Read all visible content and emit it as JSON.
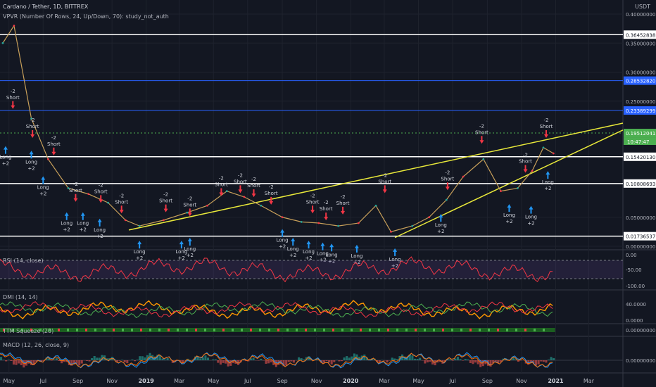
{
  "header": {
    "symbol_line": "Cardano / Tether, 1D, BITTREX",
    "indicator_line": "VPVR (Number Of Rows, 24, Up/Down, 70): study_not_auth",
    "currency": "USDT"
  },
  "price_axis": {
    "ticks": [
      "0.40000000",
      "0.35000000",
      "0.30000000",
      "0.25000000",
      "0.05000000",
      "0.00000000"
    ],
    "levels": [
      {
        "value": "0.36452838",
        "style": "white"
      },
      {
        "value": "0.28532820",
        "style": "blue"
      },
      {
        "value": "0.23389299",
        "style": "blue"
      },
      {
        "value": "0.19512041",
        "style": "green"
      },
      {
        "value": "0.15420130",
        "style": "white"
      },
      {
        "value": "0.10808693",
        "style": "white"
      },
      {
        "value": "0.01736537",
        "style": "white"
      }
    ],
    "countdown": "10:47:47"
  },
  "time_axis": [
    "May",
    "Jul",
    "Sep",
    "Nov",
    "2019",
    "Mar",
    "May",
    "Jul",
    "Sep",
    "Nov",
    "2020",
    "Mar",
    "May",
    "Jul",
    "Sep",
    "Nov",
    "2021",
    "Mar"
  ],
  "indicators": {
    "rsi": {
      "label": "RSI (14, close)",
      "ticks": [
        "0.00",
        "-50.00",
        "-100.00"
      ]
    },
    "dmi": {
      "label": "DMI (14, 14)",
      "ticks": [
        "40.0000",
        "0.0000"
      ]
    },
    "squeeze": {
      "label": "TTM Squeeze (20)",
      "ticks": [
        "0.00000000"
      ]
    },
    "macd": {
      "label": "MACD (12, 26, close, 9)",
      "ticks": [
        "0.00000000"
      ]
    }
  },
  "colors": {
    "long": "#2196f3",
    "short": "#f23645",
    "trend": "#e8e83a",
    "level_blue": "#2962ff",
    "level_green": "#4caf50"
  },
  "chart_data": {
    "type": "line",
    "title": "Cardano / Tether, 1D, BITTREX",
    "x": [
      "2018-04-20",
      "2018-05-10",
      "2018-06-10",
      "2018-07-10",
      "2018-08-15",
      "2018-09-20",
      "2018-10-25",
      "2018-11-25",
      "2018-12-20",
      "2019-02-01",
      "2019-03-15",
      "2019-04-20",
      "2019-05-25",
      "2019-06-25",
      "2019-07-25",
      "2019-09-01",
      "2019-10-05",
      "2019-11-05",
      "2019-12-10",
      "2020-01-15",
      "2020-02-15",
      "2020-03-13",
      "2020-04-20",
      "2020-05-20",
      "2020-06-20",
      "2020-07-20",
      "2020-08-25",
      "2020-09-25",
      "2020-10-25",
      "2020-11-20",
      "2020-12-10",
      "2020-12-28"
    ],
    "series": [
      {
        "values": [
          0.35,
          0.38,
          0.22,
          0.15,
          0.1,
          0.09,
          0.075,
          0.045,
          0.035,
          0.045,
          0.058,
          0.07,
          0.095,
          0.085,
          0.07,
          0.05,
          0.042,
          0.04,
          0.035,
          0.04,
          0.07,
          0.025,
          0.035,
          0.05,
          0.08,
          0.12,
          0.15,
          0.095,
          0.1,
          0.13,
          0.17,
          0.16
        ]
      }
    ],
    "ylim": [
      0,
      0.4
    ]
  },
  "annotations": [
    {
      "kind": "short",
      "text": [
        "-2",
        "Short"
      ],
      "date": "2018-05-08",
      "price": 0.25
    },
    {
      "kind": "short",
      "text": [
        "-2",
        "Short"
      ],
      "date": "2018-06-12",
      "price": 0.2
    },
    {
      "kind": "long",
      "text": [
        "Long",
        "+2"
      ],
      "date": "2018-04-25",
      "price": 0.158
    },
    {
      "kind": "long",
      "text": [
        "Long",
        "+2"
      ],
      "date": "2018-06-10",
      "price": 0.15
    },
    {
      "kind": "short",
      "text": [
        "-2",
        "Short"
      ],
      "date": "2018-07-20",
      "price": 0.17
    },
    {
      "kind": "long",
      "text": [
        "Long",
        "+2"
      ],
      "date": "2018-07-01",
      "price": 0.106
    },
    {
      "kind": "short",
      "text": [
        "-2",
        "Short"
      ],
      "date": "2018-08-28",
      "price": 0.09
    },
    {
      "kind": "long",
      "text": [
        "Long",
        "+2"
      ],
      "date": "2018-08-12",
      "price": 0.044
    },
    {
      "kind": "short",
      "text": [
        "-2",
        "Short"
      ],
      "date": "2018-10-12",
      "price": 0.088
    },
    {
      "kind": "short",
      "text": [
        "-2",
        "Short"
      ],
      "date": "2018-11-18",
      "price": 0.07
    },
    {
      "kind": "long",
      "text": [
        "Long",
        "+2"
      ],
      "date": "2018-09-10",
      "price": 0.044
    },
    {
      "kind": "long",
      "text": [
        "Long",
        "+2"
      ],
      "date": "2018-10-10",
      "price": 0.033
    },
    {
      "kind": "long",
      "text": [
        "Long",
        "+2"
      ],
      "date": "2018-12-20",
      "price": -0.005
    },
    {
      "kind": "short",
      "text": [
        "-2",
        "Short"
      ],
      "date": "2019-02-05",
      "price": 0.072
    },
    {
      "kind": "long",
      "text": [
        "Long",
        "+2"
      ],
      "date": "2019-03-05",
      "price": -0.005
    },
    {
      "kind": "short",
      "text": [
        "-2",
        "Short"
      ],
      "date": "2019-03-20",
      "price": 0.065
    },
    {
      "kind": "long",
      "text": [
        "Long",
        "+2"
      ],
      "date": "2019-03-20",
      "price": 0.0
    },
    {
      "kind": "short",
      "text": [
        "-2",
        "Short"
      ],
      "date": "2019-05-15",
      "price": 0.1
    },
    {
      "kind": "short",
      "text": [
        "-2",
        "Short"
      ],
      "date": "2019-06-18",
      "price": 0.105
    },
    {
      "kind": "short",
      "text": [
        "-2",
        "Short"
      ],
      "date": "2019-07-12",
      "price": 0.098
    },
    {
      "kind": "short",
      "text": [
        "-2",
        "Short"
      ],
      "date": "2019-08-12",
      "price": 0.085
    },
    {
      "kind": "long",
      "text": [
        "Long",
        "+2"
      ],
      "date": "2019-09-01",
      "price": 0.015
    },
    {
      "kind": "long",
      "text": [
        "Long",
        "+2"
      ],
      "date": "2019-09-20",
      "price": 0.0
    },
    {
      "kind": "short",
      "text": [
        "-2",
        "Short"
      ],
      "date": "2019-10-25",
      "price": 0.07
    },
    {
      "kind": "short",
      "text": [
        "-2",
        "Short"
      ],
      "date": "2019-11-18",
      "price": 0.058
    },
    {
      "kind": "long",
      "text": [
        "Long",
        "+2"
      ],
      "date": "2019-10-18",
      "price": -0.005
    },
    {
      "kind": "long",
      "text": [
        "Long",
        "+2"
      ],
      "date": "2019-11-12",
      "price": -0.008
    },
    {
      "kind": "long",
      "text": [
        "Long",
        "+2"
      ],
      "date": "2019-11-28",
      "price": -0.01
    },
    {
      "kind": "short",
      "text": [
        "-2",
        "Short"
      ],
      "date": "2019-12-18",
      "price": 0.068
    },
    {
      "kind": "long",
      "text": [
        "Long",
        "+2"
      ],
      "date": "2020-01-12",
      "price": -0.012
    },
    {
      "kind": "short",
      "text": [
        "-2",
        "Short"
      ],
      "date": "2020-03-02",
      "price": 0.105
    },
    {
      "kind": "long",
      "text": [
        "Long",
        "+2"
      ],
      "date": "2020-03-20",
      "price": -0.018
    },
    {
      "kind": "short",
      "text": [
        "-2",
        "Short"
      ],
      "date": "2020-06-22",
      "price": 0.11
    },
    {
      "kind": "long",
      "text": [
        "Long",
        "+2"
      ],
      "date": "2020-06-10",
      "price": 0.041
    },
    {
      "kind": "short",
      "text": [
        "-2",
        "Short"
      ],
      "date": "2020-08-22",
      "price": 0.19
    },
    {
      "kind": "short",
      "text": [
        "-2",
        "Short"
      ],
      "date": "2020-11-08",
      "price": 0.14
    },
    {
      "kind": "long",
      "text": [
        "Long",
        "+2"
      ],
      "date": "2020-10-10",
      "price": 0.058
    },
    {
      "kind": "long",
      "text": [
        "Long",
        "+2"
      ],
      "date": "2020-11-18",
      "price": 0.055
    },
    {
      "kind": "short",
      "text": [
        "-2",
        "Short"
      ],
      "date": "2020-12-15",
      "price": 0.2
    },
    {
      "kind": "long",
      "text": [
        "Long",
        "+2"
      ],
      "date": "2020-12-18",
      "price": 0.115
    }
  ]
}
